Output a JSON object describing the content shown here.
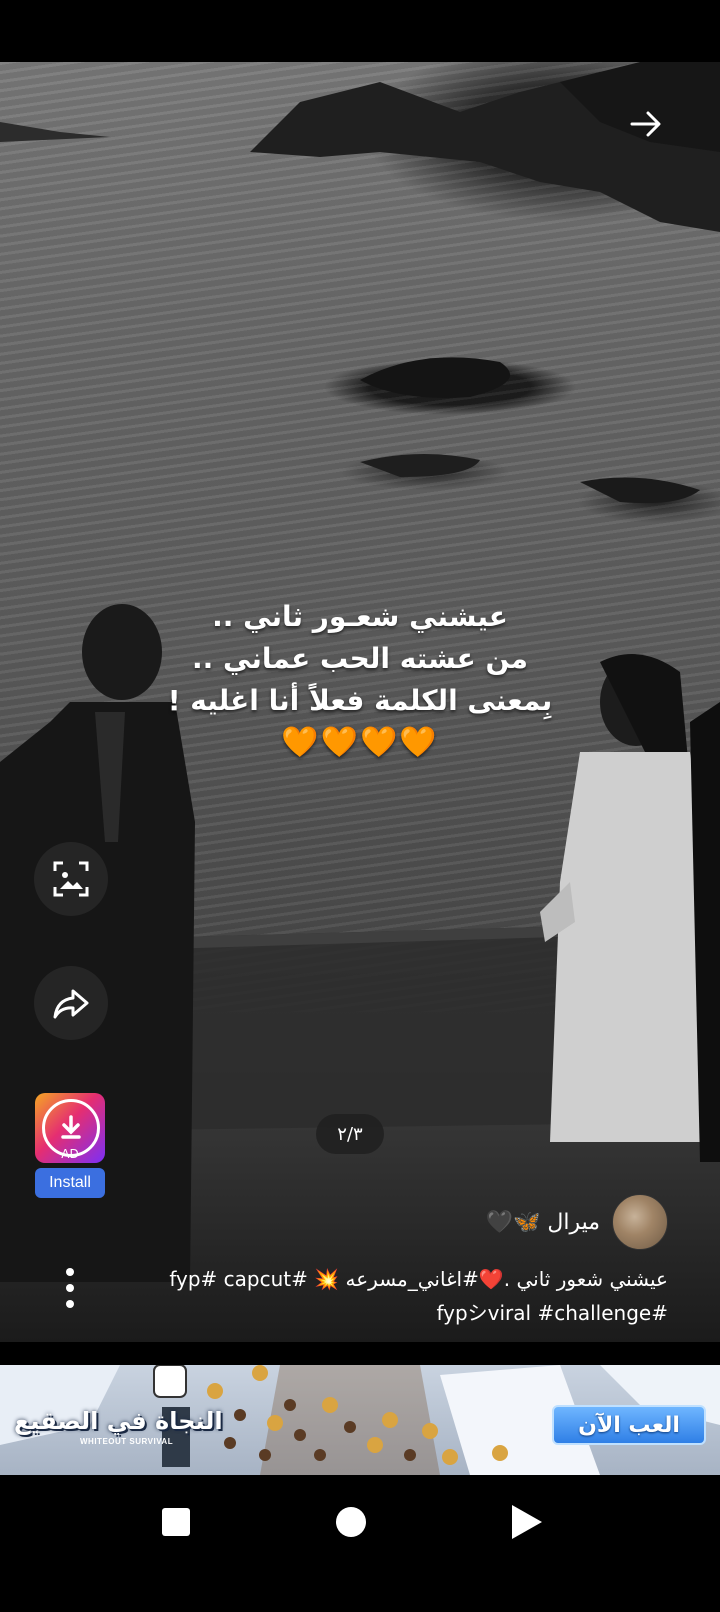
{
  "post": {
    "caption_lines": [
      "عيشني شعـور ثاني ..",
      "من عشته الحب عماني ..",
      "بِمعنى الكلمة فعلاً أنا اغليه !"
    ],
    "caption_emojis": "🧡🧡🧡🧡",
    "page_indicator": "٢/٣",
    "username": "ميرال 🦋🖤",
    "description_line1": "عيشني شعور ثاني .❤️#اغاني_مسرعه 💥 #fyp# capcut",
    "description_line2": "#fypシviral #challenge"
  },
  "ad": {
    "label": "AD",
    "install_label": "Install"
  },
  "banner": {
    "game_title": "النجاة في الصقيع",
    "game_subtitle": "WHITEOUT SURVIVAL",
    "play_label": "العب الآن"
  },
  "icons": {
    "arrow": "arrow-right-icon",
    "scan": "image-scan-icon",
    "share": "share-icon",
    "download": "download-icon",
    "more": "more-vertical-icon"
  }
}
